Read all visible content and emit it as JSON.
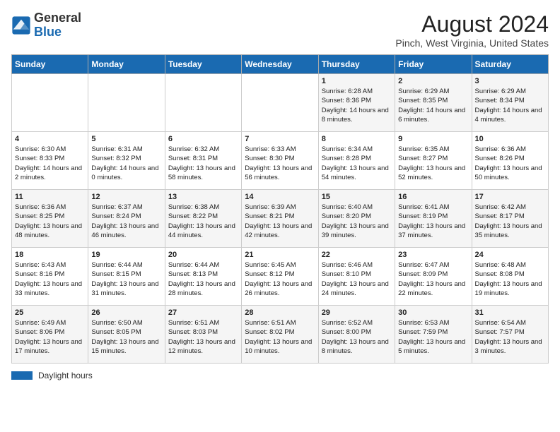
{
  "header": {
    "logo_general": "General",
    "logo_blue": "Blue",
    "title": "August 2024",
    "subtitle": "Pinch, West Virginia, United States"
  },
  "days_of_week": [
    "Sunday",
    "Monday",
    "Tuesday",
    "Wednesday",
    "Thursday",
    "Friday",
    "Saturday"
  ],
  "weeks": [
    [
      {
        "day": "",
        "info": ""
      },
      {
        "day": "",
        "info": ""
      },
      {
        "day": "",
        "info": ""
      },
      {
        "day": "",
        "info": ""
      },
      {
        "day": "1",
        "info": "Sunrise: 6:28 AM\nSunset: 8:36 PM\nDaylight: 14 hours and 8 minutes."
      },
      {
        "day": "2",
        "info": "Sunrise: 6:29 AM\nSunset: 8:35 PM\nDaylight: 14 hours and 6 minutes."
      },
      {
        "day": "3",
        "info": "Sunrise: 6:29 AM\nSunset: 8:34 PM\nDaylight: 14 hours and 4 minutes."
      }
    ],
    [
      {
        "day": "4",
        "info": "Sunrise: 6:30 AM\nSunset: 8:33 PM\nDaylight: 14 hours and 2 minutes."
      },
      {
        "day": "5",
        "info": "Sunrise: 6:31 AM\nSunset: 8:32 PM\nDaylight: 14 hours and 0 minutes."
      },
      {
        "day": "6",
        "info": "Sunrise: 6:32 AM\nSunset: 8:31 PM\nDaylight: 13 hours and 58 minutes."
      },
      {
        "day": "7",
        "info": "Sunrise: 6:33 AM\nSunset: 8:30 PM\nDaylight: 13 hours and 56 minutes."
      },
      {
        "day": "8",
        "info": "Sunrise: 6:34 AM\nSunset: 8:28 PM\nDaylight: 13 hours and 54 minutes."
      },
      {
        "day": "9",
        "info": "Sunrise: 6:35 AM\nSunset: 8:27 PM\nDaylight: 13 hours and 52 minutes."
      },
      {
        "day": "10",
        "info": "Sunrise: 6:36 AM\nSunset: 8:26 PM\nDaylight: 13 hours and 50 minutes."
      }
    ],
    [
      {
        "day": "11",
        "info": "Sunrise: 6:36 AM\nSunset: 8:25 PM\nDaylight: 13 hours and 48 minutes."
      },
      {
        "day": "12",
        "info": "Sunrise: 6:37 AM\nSunset: 8:24 PM\nDaylight: 13 hours and 46 minutes."
      },
      {
        "day": "13",
        "info": "Sunrise: 6:38 AM\nSunset: 8:22 PM\nDaylight: 13 hours and 44 minutes."
      },
      {
        "day": "14",
        "info": "Sunrise: 6:39 AM\nSunset: 8:21 PM\nDaylight: 13 hours and 42 minutes."
      },
      {
        "day": "15",
        "info": "Sunrise: 6:40 AM\nSunset: 8:20 PM\nDaylight: 13 hours and 39 minutes."
      },
      {
        "day": "16",
        "info": "Sunrise: 6:41 AM\nSunset: 8:19 PM\nDaylight: 13 hours and 37 minutes."
      },
      {
        "day": "17",
        "info": "Sunrise: 6:42 AM\nSunset: 8:17 PM\nDaylight: 13 hours and 35 minutes."
      }
    ],
    [
      {
        "day": "18",
        "info": "Sunrise: 6:43 AM\nSunset: 8:16 PM\nDaylight: 13 hours and 33 minutes."
      },
      {
        "day": "19",
        "info": "Sunrise: 6:44 AM\nSunset: 8:15 PM\nDaylight: 13 hours and 31 minutes."
      },
      {
        "day": "20",
        "info": "Sunrise: 6:44 AM\nSunset: 8:13 PM\nDaylight: 13 hours and 28 minutes."
      },
      {
        "day": "21",
        "info": "Sunrise: 6:45 AM\nSunset: 8:12 PM\nDaylight: 13 hours and 26 minutes."
      },
      {
        "day": "22",
        "info": "Sunrise: 6:46 AM\nSunset: 8:10 PM\nDaylight: 13 hours and 24 minutes."
      },
      {
        "day": "23",
        "info": "Sunrise: 6:47 AM\nSunset: 8:09 PM\nDaylight: 13 hours and 22 minutes."
      },
      {
        "day": "24",
        "info": "Sunrise: 6:48 AM\nSunset: 8:08 PM\nDaylight: 13 hours and 19 minutes."
      }
    ],
    [
      {
        "day": "25",
        "info": "Sunrise: 6:49 AM\nSunset: 8:06 PM\nDaylight: 13 hours and 17 minutes."
      },
      {
        "day": "26",
        "info": "Sunrise: 6:50 AM\nSunset: 8:05 PM\nDaylight: 13 hours and 15 minutes."
      },
      {
        "day": "27",
        "info": "Sunrise: 6:51 AM\nSunset: 8:03 PM\nDaylight: 13 hours and 12 minutes."
      },
      {
        "day": "28",
        "info": "Sunrise: 6:51 AM\nSunset: 8:02 PM\nDaylight: 13 hours and 10 minutes."
      },
      {
        "day": "29",
        "info": "Sunrise: 6:52 AM\nSunset: 8:00 PM\nDaylight: 13 hours and 8 minutes."
      },
      {
        "day": "30",
        "info": "Sunrise: 6:53 AM\nSunset: 7:59 PM\nDaylight: 13 hours and 5 minutes."
      },
      {
        "day": "31",
        "info": "Sunrise: 6:54 AM\nSunset: 7:57 PM\nDaylight: 13 hours and 3 minutes."
      }
    ]
  ],
  "legend": {
    "daylight_label": "Daylight hours"
  }
}
